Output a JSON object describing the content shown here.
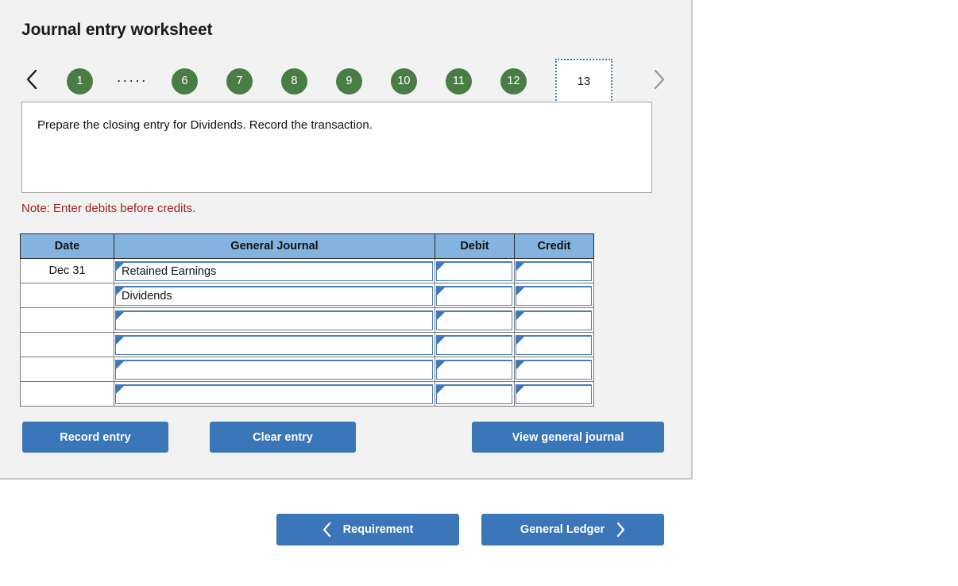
{
  "worksheet": {
    "title": "Journal entry worksheet",
    "instruction": "Prepare the closing entry for Dividends. Record the transaction.",
    "note": "Note: Enter debits before credits."
  },
  "tabs": {
    "prev_icon": "chevron-left-icon",
    "next_icon": "chevron-right-icon",
    "items": [
      "1",
      "6",
      "7",
      "8",
      "9",
      "10",
      "11",
      "12"
    ],
    "ellipsis": ".....",
    "active": "13"
  },
  "table": {
    "headers": [
      "Date",
      "General Journal",
      "Debit",
      "Credit"
    ],
    "rows": [
      {
        "date": "Dec 31",
        "account": "Retained Earnings",
        "debit": "",
        "credit": ""
      },
      {
        "date": "",
        "account": "Dividends",
        "debit": "",
        "credit": ""
      },
      {
        "date": "",
        "account": "",
        "debit": "",
        "credit": ""
      },
      {
        "date": "",
        "account": "",
        "debit": "",
        "credit": ""
      },
      {
        "date": "",
        "account": "",
        "debit": "",
        "credit": ""
      },
      {
        "date": "",
        "account": "",
        "debit": "",
        "credit": ""
      }
    ]
  },
  "actions": {
    "record": "Record entry",
    "clear": "Clear entry",
    "view_general_journal": "View general journal"
  },
  "footer_nav": {
    "prev_label": "Requirement",
    "prev_icon": "chevron-left-icon",
    "next_label": "General Ledger",
    "next_icon": "chevron-right-icon"
  },
  "colors": {
    "tab_green": "#4a7c45",
    "button_blue": "#3a76b8",
    "table_header_blue": "#85b3e0",
    "note_red": "#a02020",
    "input_border_blue": "#4a7ebb"
  }
}
